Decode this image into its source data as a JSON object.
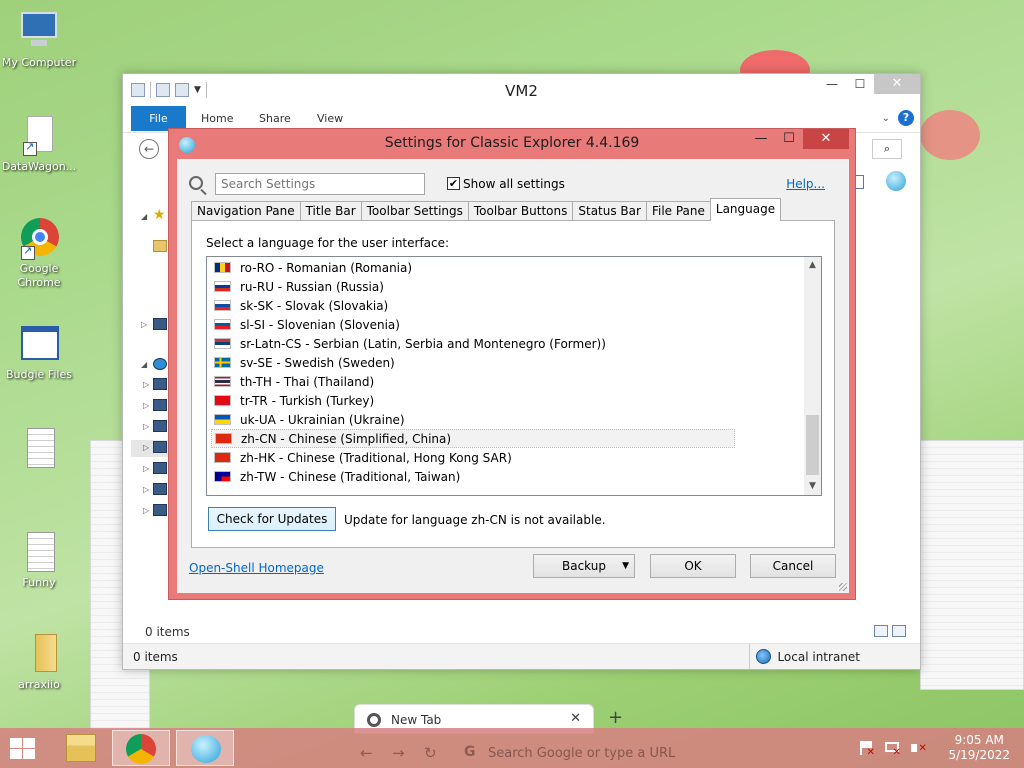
{
  "desktop": {
    "icons": [
      {
        "label": "My Computer"
      },
      {
        "label": "DataWagon..."
      },
      {
        "label": "Google Chrome"
      },
      {
        "label": "Budgie Files"
      },
      {
        "label": ""
      },
      {
        "label": "Funny"
      },
      {
        "label": "arraxiio"
      }
    ]
  },
  "explorer": {
    "title": "VM2",
    "ribbon_tabs": [
      "File",
      "Home",
      "Share",
      "View"
    ],
    "status_items": "0 items",
    "status_bar_items": "0 items",
    "status_zone": "Local intranet"
  },
  "dialog": {
    "title": "Settings for Classic Explorer 4.4.169",
    "search_placeholder": "Search Settings",
    "show_all_label": "Show all settings",
    "show_all_checked": true,
    "help_link": "Help...",
    "tabs": [
      "Navigation Pane",
      "Title Bar",
      "Toolbar Settings",
      "Toolbar Buttons",
      "Status Bar",
      "File Pane",
      "Language"
    ],
    "active_tab": "Language",
    "panel_label": "Select a language for the user interface:",
    "languages": [
      {
        "text": "ro-RO - Romanian (Romania)",
        "flag": "ro"
      },
      {
        "text": "ru-RU - Russian (Russia)",
        "flag": "ru"
      },
      {
        "text": "sk-SK - Slovak (Slovakia)",
        "flag": "sk"
      },
      {
        "text": "sl-SI - Slovenian (Slovenia)",
        "flag": "si"
      },
      {
        "text": "sr-Latn-CS - Serbian (Latin, Serbia and Montenegro (Former))",
        "flag": "rs"
      },
      {
        "text": "sv-SE - Swedish (Sweden)",
        "flag": "se"
      },
      {
        "text": "th-TH - Thai (Thailand)",
        "flag": "th"
      },
      {
        "text": "tr-TR - Turkish (Turkey)",
        "flag": "tr"
      },
      {
        "text": "uk-UA - Ukrainian (Ukraine)",
        "flag": "ua"
      },
      {
        "text": "zh-CN - Chinese (Simplified, China)",
        "flag": "cn",
        "selected": true
      },
      {
        "text": "zh-HK - Chinese (Traditional, Hong Kong SAR)",
        "flag": "hk"
      },
      {
        "text": "zh-TW - Chinese (Traditional, Taiwan)",
        "flag": "tw"
      }
    ],
    "check_updates_label": "Check for Updates",
    "update_message": "Update for language zh-CN is not available.",
    "homepage_link": "Open-Shell Homepage",
    "backup_label": "Backup",
    "ok_label": "OK",
    "cancel_label": "Cancel"
  },
  "chrome": {
    "tab_title": "New Tab",
    "omnibox_placeholder": "Search Google or type a URL"
  },
  "taskbar": {
    "time": "9:05 AM",
    "date": "5/19/2022"
  },
  "colors": {
    "dialog_frame": "#e97a7a",
    "file_tab": "#1979ca",
    "link": "#0066cc",
    "taskbar": "#d68080"
  }
}
